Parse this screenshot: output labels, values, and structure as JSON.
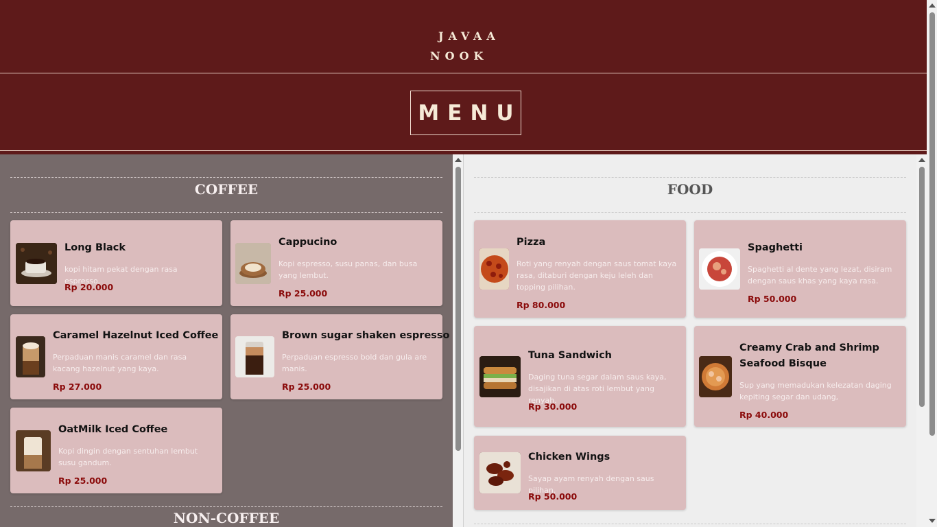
{
  "brand": {
    "line1": "JAVAA",
    "line2": "NOOK"
  },
  "menu_title": "MENU",
  "coffee": {
    "title": "COFFEE",
    "items": [
      {
        "name": "Long Black",
        "desc": "kopi hitam pekat dengan rasa espresso.",
        "price": "Rp 20.000"
      },
      {
        "name": "Cappucino",
        "desc": "Kopi espresso, susu panas, dan busa yang lembut.",
        "price": "Rp 25.000"
      },
      {
        "name": "Caramel Hazelnut Iced Coffee",
        "desc": "Perpaduan manis caramel dan rasa kacang hazelnut yang kaya.",
        "price": "Rp 27.000"
      },
      {
        "name": "Brown sugar shaken espresso",
        "desc": "Perpaduan espresso bold dan gula are manis.",
        "price": "Rp 25.000"
      },
      {
        "name": "OatMilk Iced Coffee",
        "desc": "Kopi dingin dengan sentuhan lembut susu gandum.",
        "price": "Rp 25.000"
      }
    ]
  },
  "non_coffee": {
    "title": "NON-COFFEE"
  },
  "food": {
    "title": "FOOD",
    "items": [
      {
        "name": "Pizza",
        "desc": "Roti yang renyah dengan saus tomat kaya rasa, ditaburi dengan keju leleh dan topping pilihan.",
        "price": "Rp 80.000"
      },
      {
        "name": "Spaghetti",
        "desc": "Spaghetti al dente yang lezat, disiram dengan saus khas yang kaya rasa.",
        "price": "Rp 50.000"
      },
      {
        "name": "Tuna Sandwich",
        "desc": "Daging tuna segar dalam saus kaya, disajikan di atas roti lembut yang renyah.",
        "price": "Rp 30.000"
      },
      {
        "name": "Creamy Crab and Shrimp Seafood Bisque",
        "desc": "Sup yang memadukan kelezatan daging kepiting segar dan udang,",
        "price": "Rp 40.000"
      },
      {
        "name": "Chicken Wings",
        "desc": "Sayap ayam renyah dengan saus pilihan.",
        "price": "Rp 50.000"
      }
    ]
  },
  "colors": {
    "header_bg": "#5e1a1a",
    "card_bg": "#dbbcbd",
    "price": "#8a0a0a",
    "coffee_panel_bg": "#766a6a"
  }
}
